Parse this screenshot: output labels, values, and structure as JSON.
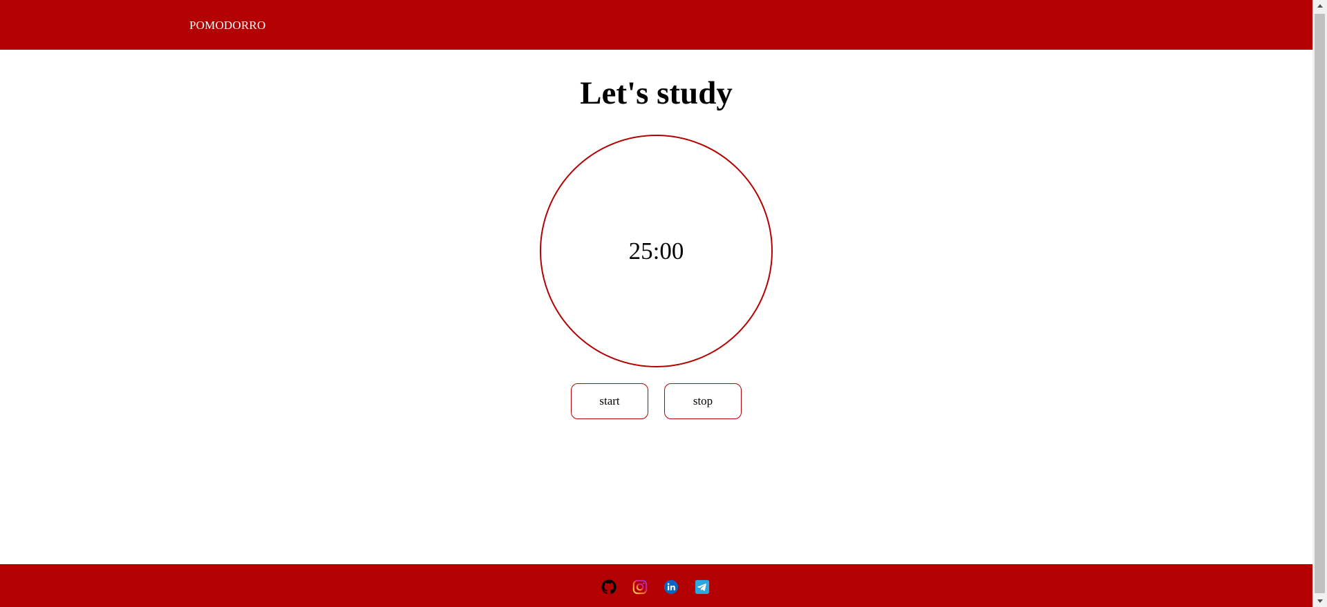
{
  "header": {
    "brand": "POMODORRO",
    "background_color": "#b30000"
  },
  "main": {
    "title": "Let's study",
    "timer": {
      "display": "25:00",
      "ring_color": "#b30000"
    },
    "buttons": {
      "start_label": "start",
      "stop_label": "stop"
    }
  },
  "footer": {
    "background_color": "#b30000",
    "social_links": [
      {
        "icon": "github-icon",
        "color": "#000000"
      },
      {
        "icon": "instagram-icon",
        "color": "#e1306c"
      },
      {
        "icon": "linkedin-icon",
        "color": "#0a66c2"
      },
      {
        "icon": "telegram-icon",
        "color": "#2ca5e0"
      }
    ]
  }
}
